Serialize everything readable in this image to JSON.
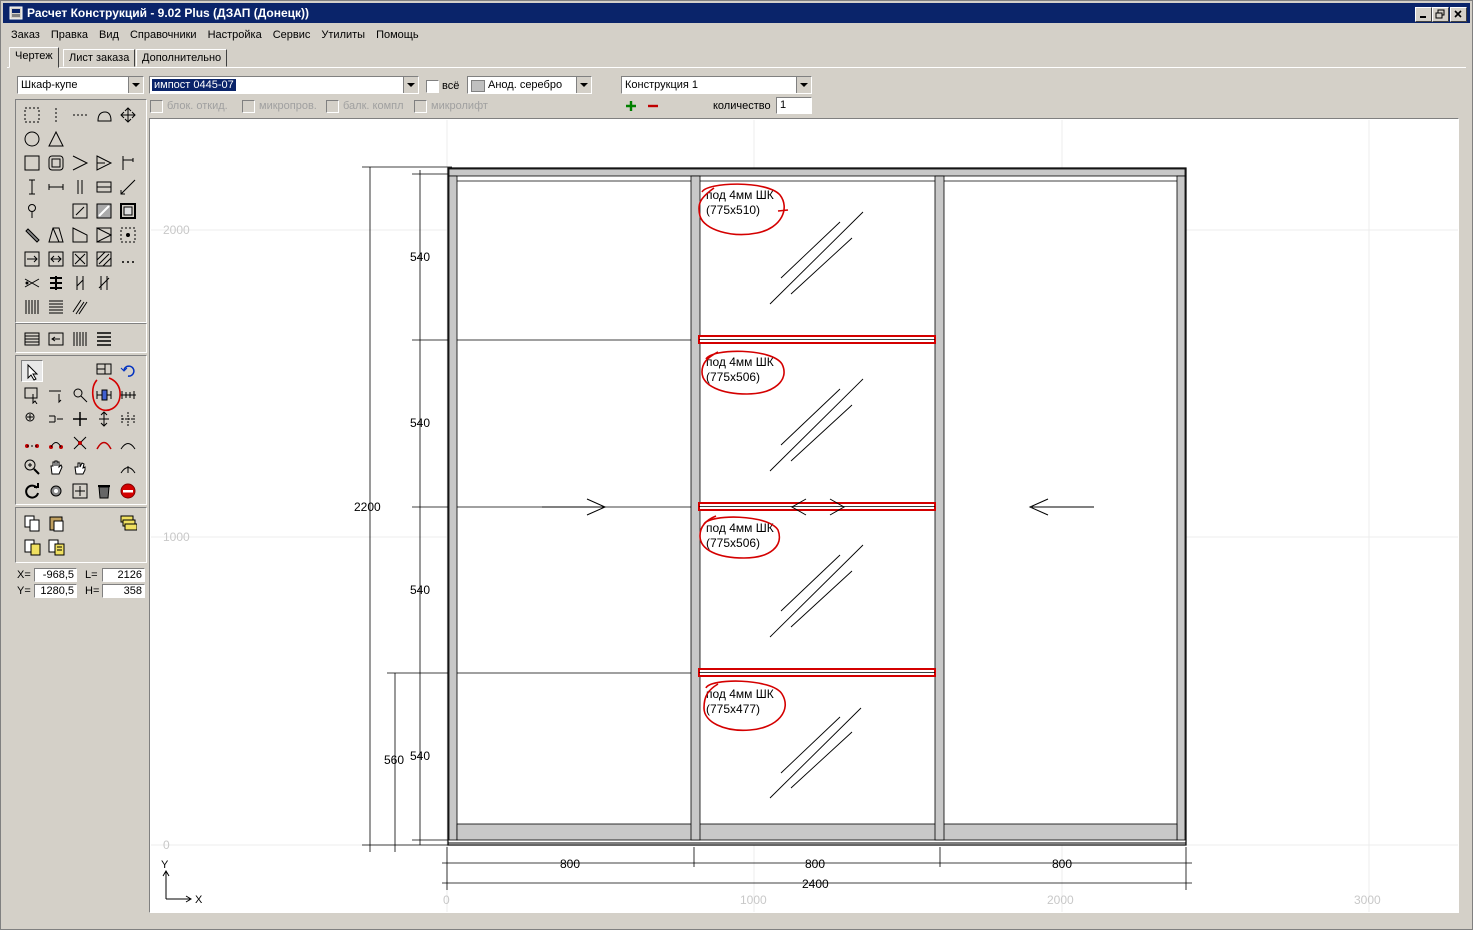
{
  "window": {
    "title": "Расчет Конструкций - 9.02 Plus (ДЗАП (Донецк))"
  },
  "menu": [
    "Заказ",
    "Правка",
    "Вид",
    "Справочники",
    "Настройка",
    "Сервис",
    "Утилиты",
    "Помощь"
  ],
  "tabs": [
    {
      "label": "Чертеж",
      "active": true
    },
    {
      "label": "Лист заказа",
      "active": false
    },
    {
      "label": "Дополнительно",
      "active": false
    }
  ],
  "options": {
    "product_type": "Шкаф-купе",
    "profile": "импост 0445-07",
    "all_label": "всё",
    "color": "Анод. серебро",
    "construction": "Конструкция 1",
    "quantity_label": "количество",
    "quantity": "1",
    "checkboxes": [
      "блок. откид.",
      "микропров.",
      "балк. компл",
      "микролифт"
    ]
  },
  "coords": {
    "x_label": "X=",
    "x": "-968,5",
    "y_label": "Y=",
    "y": "1280,5",
    "l_label": "L=",
    "l": "2126",
    "h_label": "H=",
    "h": "358"
  },
  "drawing": {
    "overall_height": "2200",
    "overall_width": "2400",
    "bottom_section_height": "560",
    "section_heights": [
      "540",
      "540",
      "540",
      "540"
    ],
    "section_widths": [
      "800",
      "800",
      "800"
    ],
    "axis_x_labels": [
      "0",
      "1000",
      "2000",
      "3000"
    ],
    "axis_y_labels": [
      "2000",
      "1000",
      "0"
    ],
    "axis_x_name": "X",
    "axis_y_name": "Y",
    "panels": [
      {
        "line1": "под 4мм ШК",
        "line2": "(775x510)"
      },
      {
        "line1": "под 4мм ШК",
        "line2": "(775x506)"
      },
      {
        "line1": "под 4мм ШК",
        "line2": "(775x506)"
      },
      {
        "line1": "под 4мм ШК",
        "line2": "(775x477)"
      }
    ],
    "accent_color": "#d40000"
  }
}
